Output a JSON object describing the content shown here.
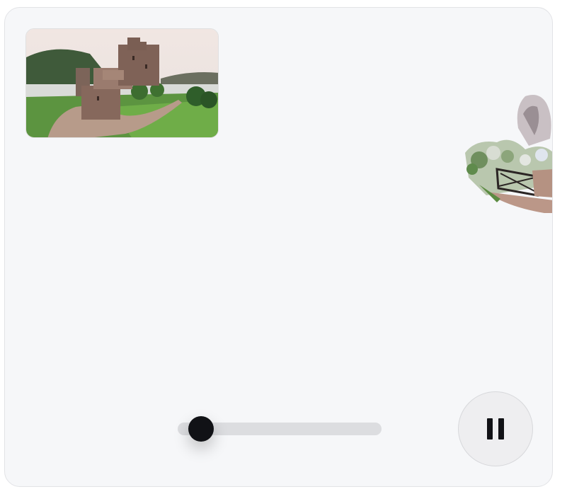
{
  "viewer": {
    "thumbnail_alt": "castle-thumbnail",
    "background_color": "#f6f7f9"
  },
  "playback": {
    "state": "playing",
    "progress_fraction": 0.06,
    "control_icon": "pause-icon"
  },
  "colors": {
    "accent": "#111216",
    "track": "#dcdde0",
    "button_bg": "#eeeef0"
  }
}
